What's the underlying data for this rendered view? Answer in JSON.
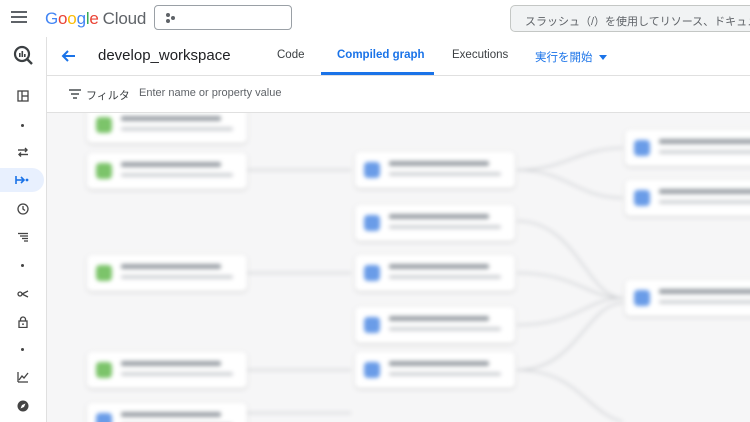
{
  "topbar": {
    "logo": {
      "letters": [
        "G",
        "o",
        "o",
        "g",
        "l",
        "e"
      ],
      "suffix": "Cloud"
    },
    "project_picker_icon": "project-dots-icon",
    "search_placeholder": "スラッシュ（/）を使用してリソース、ドキュメント"
  },
  "leftnav": {
    "items": [
      {
        "icon": "bigquery-icon"
      },
      {
        "icon": "overview-icon"
      },
      {
        "icon": "transfers-icon"
      },
      {
        "icon": "dataform-icon",
        "active": true
      },
      {
        "icon": "scheduling-icon"
      },
      {
        "icon": "pipelines-icon"
      },
      {
        "icon": "sharing-icon"
      },
      {
        "icon": "lock-icon"
      },
      {
        "icon": "monitoring-icon"
      },
      {
        "icon": "explore-icon"
      }
    ]
  },
  "header": {
    "title": "develop_workspace",
    "tabs": [
      {
        "label": "Code",
        "active": false
      },
      {
        "label": "Compiled graph",
        "active": true
      },
      {
        "label": "Executions",
        "active": false
      }
    ],
    "run_label": "実行を開始"
  },
  "filterbar": {
    "label": "フィルタ",
    "placeholder": "Enter name or property value"
  },
  "colors": {
    "accent": "#1a73e8",
    "node_declaration": "#7cc46a",
    "node_table": "#6a9ce8"
  },
  "graph": {
    "nodes": [
      {
        "type": "declaration"
      },
      {
        "type": "declaration"
      },
      {
        "type": "declaration"
      },
      {
        "type": "declaration"
      },
      {
        "type": "table"
      },
      {
        "type": "table"
      },
      {
        "type": "table"
      },
      {
        "type": "table"
      },
      {
        "type": "table"
      },
      {
        "type": "table"
      },
      {
        "type": "table"
      },
      {
        "type": "table"
      },
      {
        "type": "table"
      },
      {
        "type": "table"
      }
    ]
  }
}
